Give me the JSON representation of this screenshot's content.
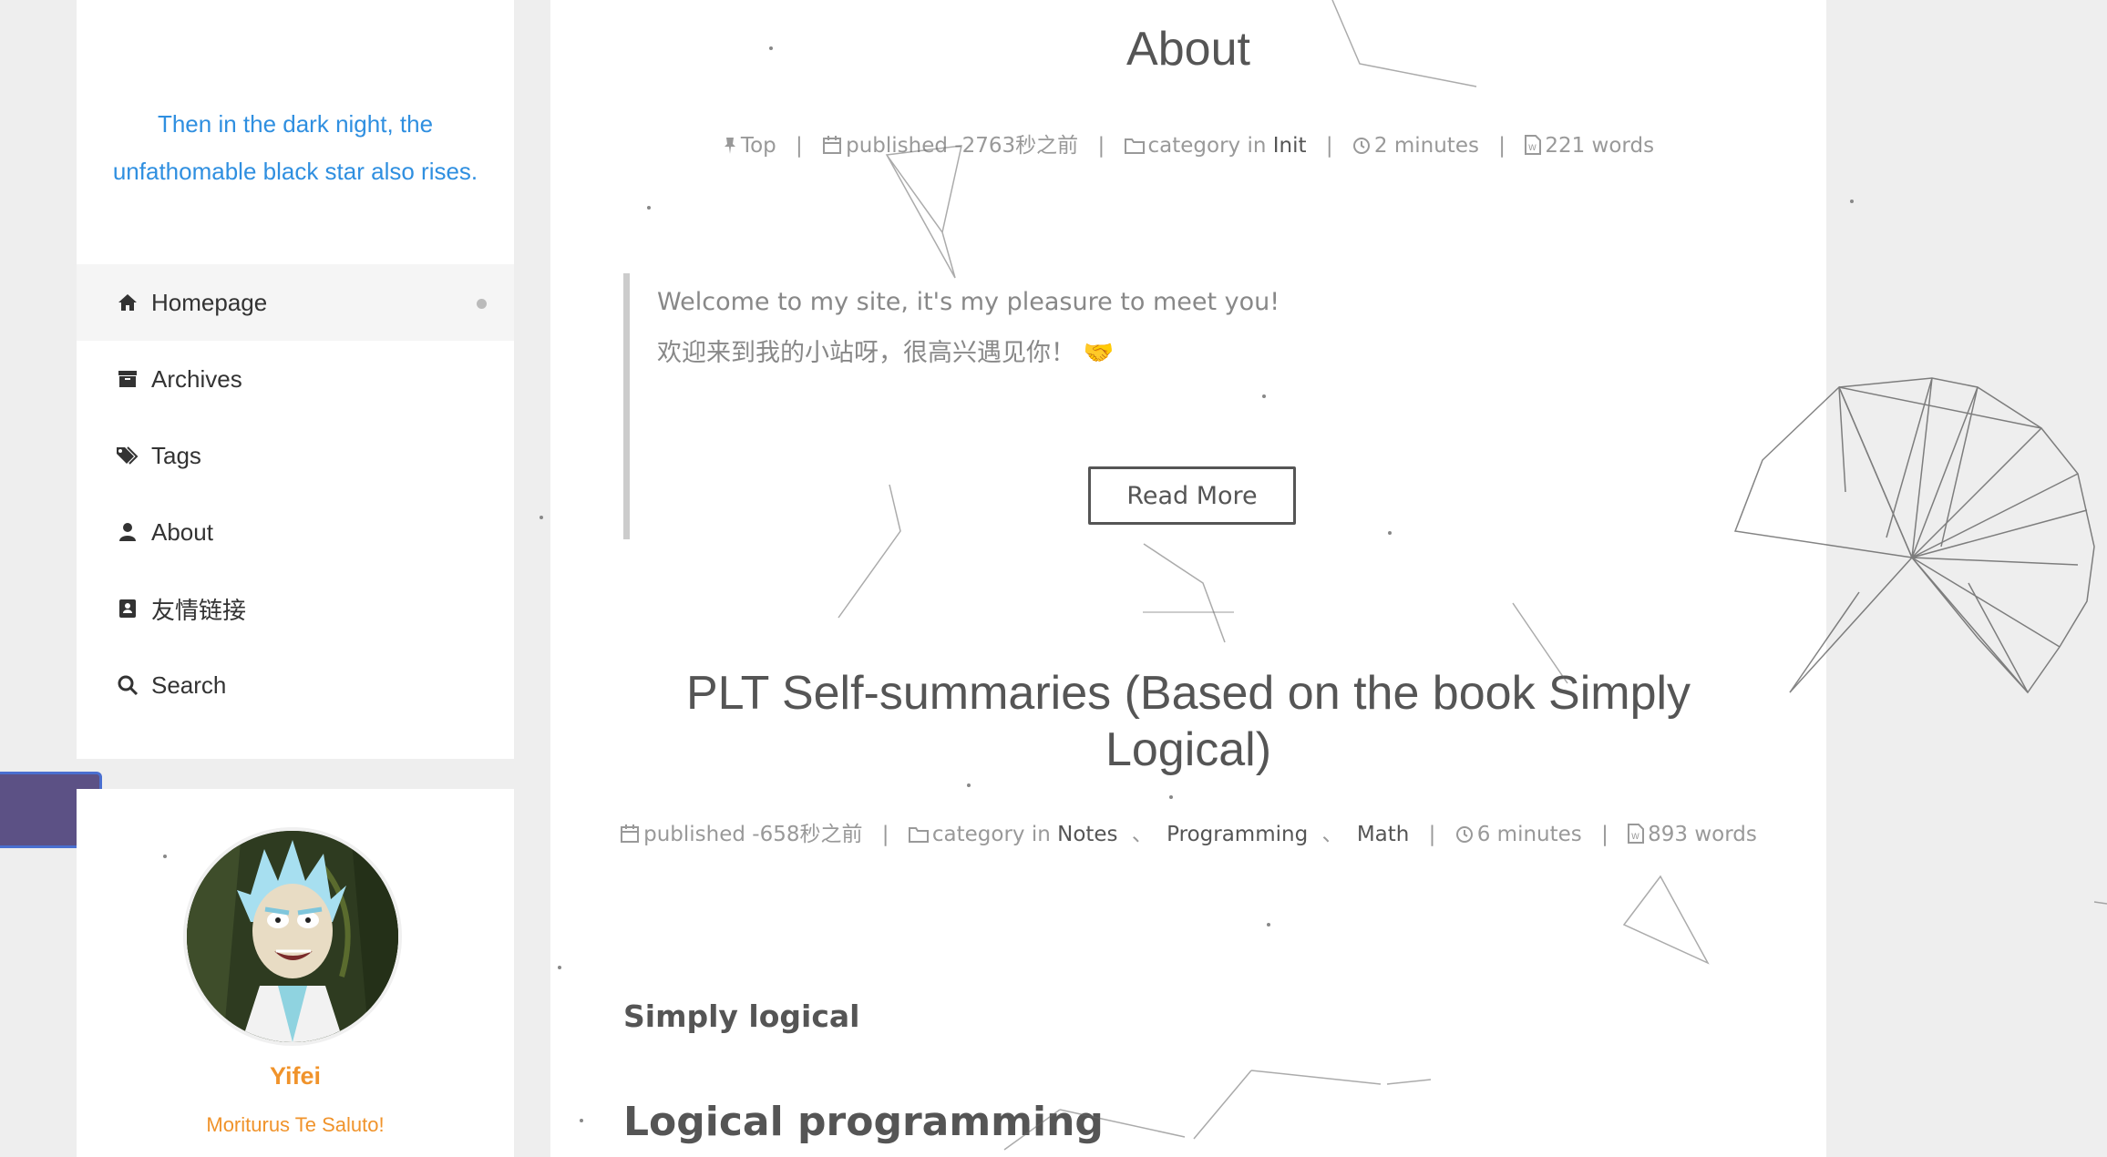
{
  "sidebar": {
    "subtitle_line1": "Then in the dark night, the",
    "subtitle_line2": "unfathomable black star also rises.",
    "menu": [
      {
        "label": "Homepage",
        "icon": "home-icon"
      },
      {
        "label": "Archives",
        "icon": "archive-icon"
      },
      {
        "label": "Tags",
        "icon": "tags-icon"
      },
      {
        "label": "About",
        "icon": "user-icon"
      },
      {
        "label": "友情链接",
        "icon": "address-book-icon"
      },
      {
        "label": "Search",
        "icon": "search-icon"
      }
    ],
    "author": {
      "name": "Yifei",
      "motto": "Moriturus Te Saluto!"
    }
  },
  "posts": [
    {
      "title": "About",
      "meta": {
        "pinned": "Top",
        "published": "published -2763秒之前",
        "category_prefix": "category in",
        "categories": [
          "Init"
        ],
        "reading_time": "2 minutes",
        "word_count": "221 words"
      },
      "excerpt_line1": "Welcome to my site, it's my pleasure to meet you!",
      "excerpt_line2": "欢迎来到我的小站呀，很高兴遇见你！",
      "excerpt_emoji": "🤝",
      "read_more": "Read More"
    },
    {
      "title_line1": "PLT Self-summaries (Based on the book Simply",
      "title_line2": "Logical)",
      "meta": {
        "published": "published -658秒之前",
        "category_prefix": "category in",
        "categories": [
          "Notes",
          "Programming",
          "Math"
        ],
        "category_separator": "、",
        "reading_time": "6 minutes",
        "word_count": "893 words"
      },
      "heading1": "Simply logical",
      "heading2": "Logical programming"
    }
  ],
  "colors": {
    "accent_blue": "#2f8fe0",
    "author_orange": "#f0932b",
    "toggle_purple": "#5c5185",
    "mini_button_purple": "#6b3fa0"
  }
}
